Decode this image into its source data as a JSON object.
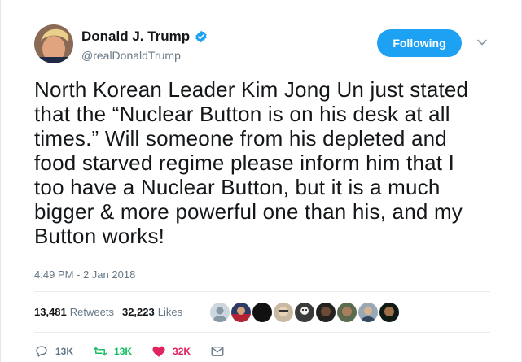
{
  "tweet": {
    "author_name": "Donald J. Trump",
    "handle": "@realDonaldTrump",
    "follow_label": "Following",
    "text_lines": [
      "North Korean Leader Kim Jong Un just stated",
      "that the “Nuclear Button is on his desk at all",
      "times.” Will someone from his depleted and",
      "food starved regime please inform him that I",
      "too have a Nuclear Button, but it is a much",
      "bigger & more powerful one than his, and my",
      "Button works!"
    ],
    "timestamp": "4:49 PM - 2 Jan 2018",
    "retweets_count": "13,481",
    "retweets_label": "Retweets",
    "likes_count": "32,223",
    "likes_label": "Likes",
    "reply_count": "13K",
    "retweet_action_count": "13K",
    "like_action_count": "32K"
  },
  "colors": {
    "accent": "#1da1f2",
    "retweet": "#17bf63",
    "like": "#e0245e",
    "muted": "#657786"
  },
  "icons": [
    "verified-badge-icon",
    "chevron-down-icon",
    "reply-icon",
    "retweet-icon",
    "heart-icon",
    "message-icon"
  ]
}
